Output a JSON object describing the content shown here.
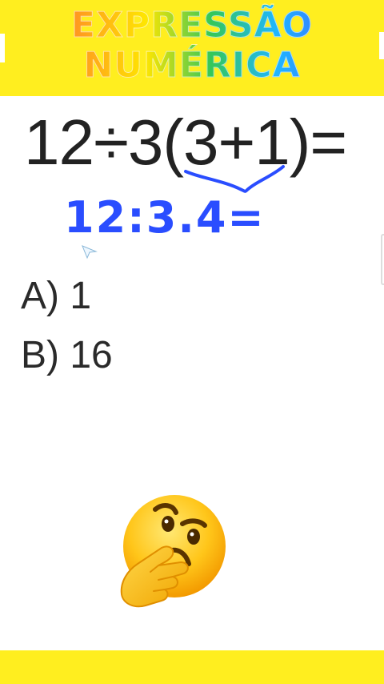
{
  "header": {
    "title_line1": "EXPRESSÃO",
    "title_line2": "NUMÉRICA",
    "background_color": "#ffee1f"
  },
  "question": {
    "equation": "12÷3(3+1)=",
    "handwritten_step": "12:3.4="
  },
  "options": [
    {
      "label": "A) 1"
    },
    {
      "label": "B) 16"
    }
  ],
  "icons": {
    "annotation_color": "#2a4dff",
    "thinking_emoji": "thinking-face-icon",
    "cursor": "cursor-arrow-icon"
  },
  "footer": {
    "background_color": "#ffee1f"
  }
}
